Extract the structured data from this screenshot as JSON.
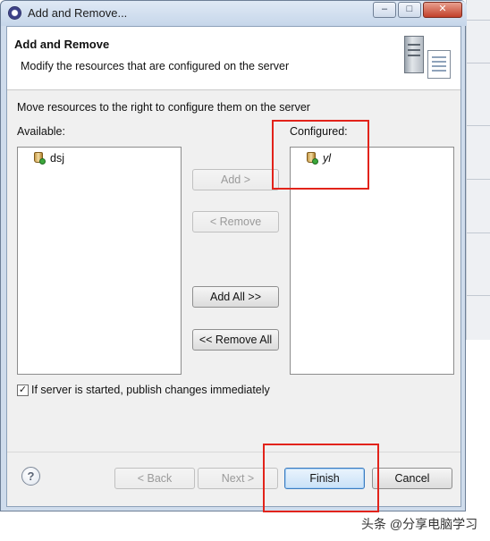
{
  "window": {
    "title": "Add and Remove...",
    "controls": {
      "minimize": "–",
      "maximize": "□",
      "close": "✕"
    }
  },
  "header": {
    "title": "Add and Remove",
    "description": "Modify the resources that are configured on the server"
  },
  "instructions": "Move resources to the right to configure them on the server",
  "available": {
    "label": "Available:",
    "items": [
      "dsj"
    ]
  },
  "configured": {
    "label": "Configured:",
    "items": [
      "yl"
    ]
  },
  "buttons": {
    "add": "Add >",
    "remove": "< Remove",
    "add_all": "Add All >>",
    "remove_all": "<< Remove All",
    "back": "< Back",
    "next": "Next >",
    "finish": "Finish",
    "cancel": "Cancel",
    "help": "?"
  },
  "publish_option": {
    "label": "If server is started, publish changes immediately",
    "checked": true,
    "mark": "✓"
  },
  "watermark": "头条 @分享电脑学习",
  "colors": {
    "highlight": "#e2231a",
    "title_bar": "#cfdcec",
    "dialog_bg": "#f0f0f0"
  }
}
